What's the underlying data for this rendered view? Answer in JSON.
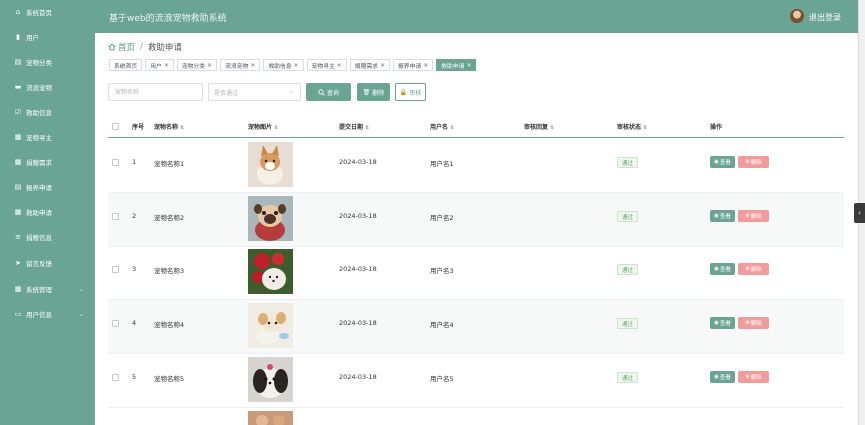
{
  "header": {
    "title": "基于web的流浪宠物救助系统",
    "logout": "退出登录"
  },
  "sidebar": {
    "items": [
      {
        "label": "系统首页",
        "icon": "home-icon"
      },
      {
        "label": "用户",
        "icon": "bar-chart-icon"
      },
      {
        "label": "宠物分类",
        "icon": "clipboard-icon"
      },
      {
        "label": "流浪宠物",
        "icon": "truck-icon"
      },
      {
        "label": "救助信息",
        "icon": "check-square-icon"
      },
      {
        "label": "宠物寻主",
        "icon": "grid-icon"
      },
      {
        "label": "捐赠需求",
        "icon": "grid-icon"
      },
      {
        "label": "报养申请",
        "icon": "clipboard-icon"
      },
      {
        "label": "救助申请",
        "icon": "grid-icon"
      },
      {
        "label": "捐赠信息",
        "icon": "sliders-icon"
      },
      {
        "label": "留言反馈",
        "icon": "send-icon"
      },
      {
        "label": "系统管理",
        "icon": "grid-icon",
        "expandable": true
      },
      {
        "label": "用户信息",
        "icon": "window-icon",
        "expandable": true
      }
    ]
  },
  "breadcrumb": {
    "home": "首页",
    "separator": "/",
    "current": "救助申请"
  },
  "tags": [
    {
      "label": "系统首页",
      "closable": false,
      "active": false
    },
    {
      "label": "用户",
      "closable": true,
      "active": false
    },
    {
      "label": "宠物分类",
      "closable": true,
      "active": false
    },
    {
      "label": "流浪宠物",
      "closable": true,
      "active": false
    },
    {
      "label": "救助信息",
      "closable": true,
      "active": false
    },
    {
      "label": "宠物寻主",
      "closable": true,
      "active": false
    },
    {
      "label": "捐赠需求",
      "closable": true,
      "active": false
    },
    {
      "label": "报养申请",
      "closable": true,
      "active": false
    },
    {
      "label": "救助申请",
      "closable": true,
      "active": true
    }
  ],
  "search": {
    "name_placeholder": "宠物名称",
    "status_placeholder": "是否通过",
    "query_label": "查询",
    "delete_label": "删除",
    "audit_label": "审核"
  },
  "table": {
    "columns": [
      "序号",
      "宠物名称",
      "宠物图片",
      "提交日期",
      "用户名",
      "审核回复",
      "审核状态",
      "操作"
    ],
    "rows": [
      {
        "index": "1",
        "pet_name": "宠物名称1",
        "date": "2024-03-18",
        "username": "用户名1",
        "reply": "",
        "status": "通过",
        "image": "corgi"
      },
      {
        "index": "2",
        "pet_name": "宠物名称2",
        "date": "2024-03-18",
        "username": "用户名2",
        "reply": "",
        "status": "通过",
        "image": "pug"
      },
      {
        "index": "3",
        "pet_name": "宠物名称3",
        "date": "2024-03-18",
        "username": "用户名3",
        "reply": "",
        "status": "通过",
        "image": "pom-roses"
      },
      {
        "index": "4",
        "pet_name": "宠物名称4",
        "date": "2024-03-18",
        "username": "用户名4",
        "reply": "",
        "status": "通过",
        "image": "chihuahua"
      },
      {
        "index": "5",
        "pet_name": "宠物名称5",
        "date": "2024-03-18",
        "username": "用户名5",
        "reply": "",
        "status": "通过",
        "image": "shih-tzu"
      }
    ],
    "view_label": "查看",
    "delete_label": "删除"
  },
  "colors": {
    "primary": "#6aa594",
    "danger": "#f29b9b",
    "success": "#67a867"
  }
}
